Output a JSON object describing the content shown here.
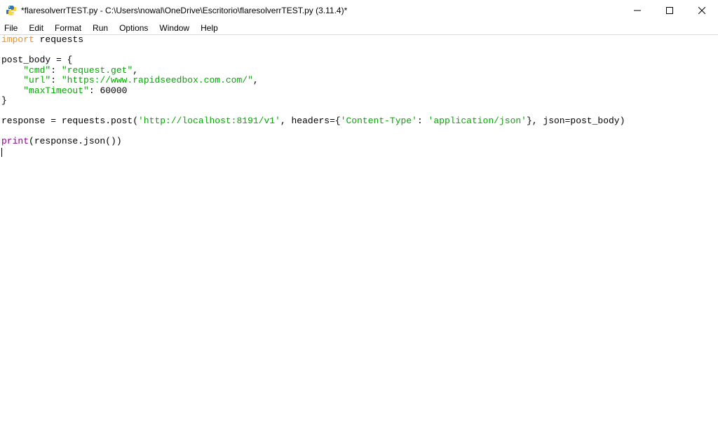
{
  "window": {
    "title": "*flaresolverrTEST.py - C:\\Users\\nowal\\OneDrive\\Escritorio\\flaresolverrTEST.py (3.11.4)*"
  },
  "menu": {
    "file": "File",
    "edit": "Edit",
    "format": "Format",
    "run": "Run",
    "options": "Options",
    "window": "Window",
    "help": "Help"
  },
  "code": {
    "l1_import": "import",
    "l1_requests": " requests",
    "l3_post_body": "post_body = {",
    "l4_indent": "    ",
    "l4_key": "\"cmd\"",
    "l4_colon": ": ",
    "l4_val": "\"request.get\"",
    "l4_comma": ",",
    "l5_indent": "    ",
    "l5_key": "\"url\"",
    "l5_colon": ": ",
    "l5_val": "\"https://www.rapidseedbox.com.com/\"",
    "l5_comma": ",",
    "l6_indent": "    ",
    "l6_key": "\"maxTimeout\"",
    "l6_colon": ": ",
    "l6_val": "60000",
    "l7_close": "}",
    "l9_a": "response = requests.post(",
    "l9_url": "'http://localhost:8191/v1'",
    "l9_b": ", headers={",
    "l9_hkey": "'Content-Type'",
    "l9_c": ": ",
    "l9_hval": "'application/json'",
    "l9_d": "}, json=post_body)",
    "l11_print": "print",
    "l11_rest": "(response.json())"
  }
}
